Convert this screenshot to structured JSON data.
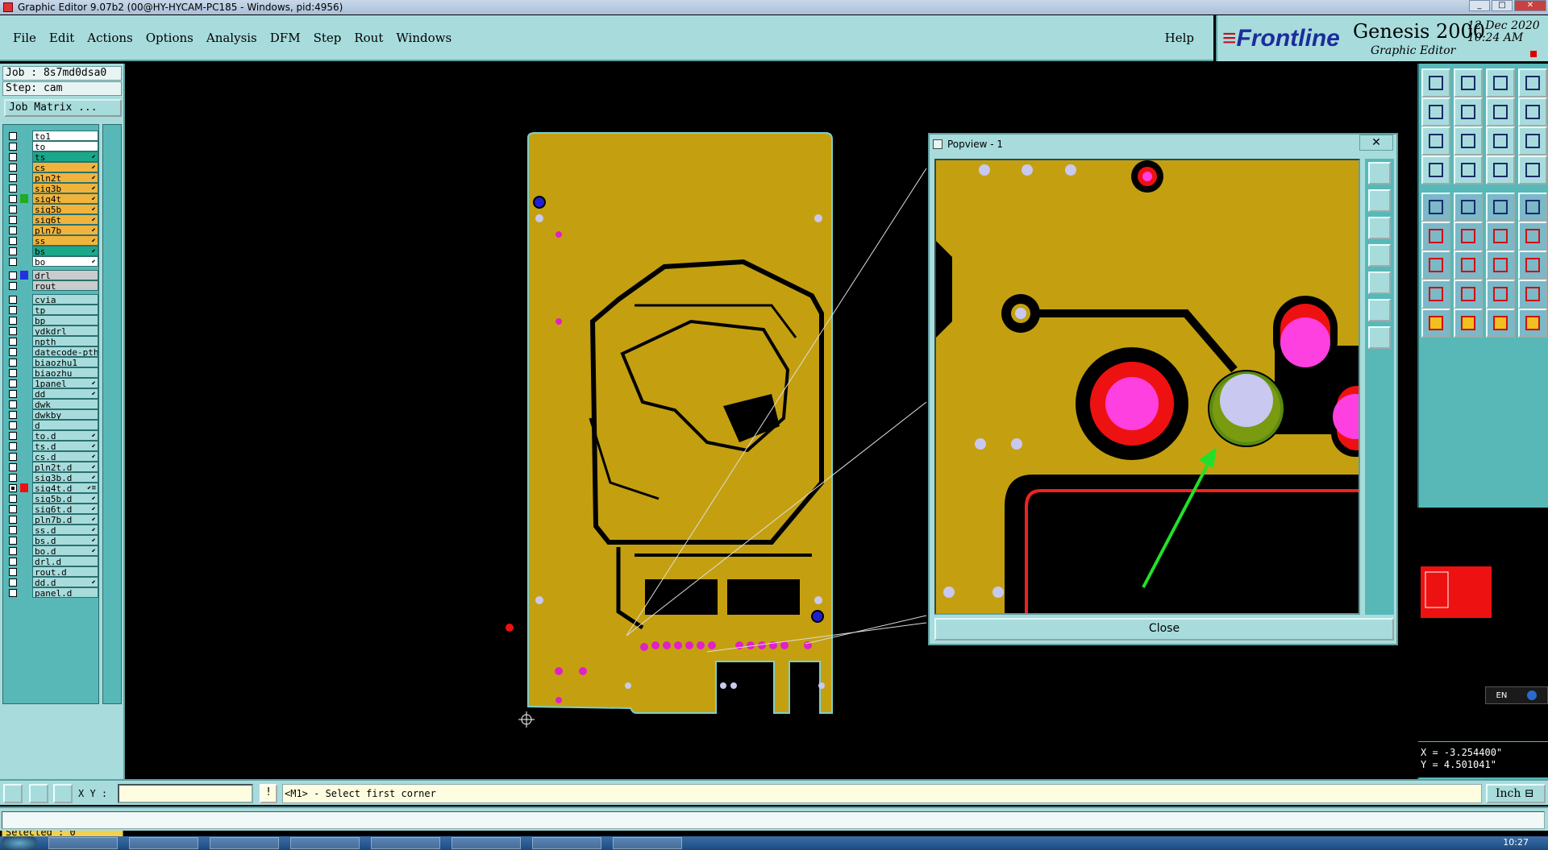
{
  "window": {
    "title": "Graphic Editor 9.07b2 (00@HY-HYCAM-PC185 - Windows, pid:4956)"
  },
  "menu": {
    "items": [
      "File",
      "Edit",
      "Actions",
      "Options",
      "Analysis",
      "DFM",
      "Step",
      "Rout",
      "Windows"
    ],
    "help": "Help"
  },
  "brand": {
    "logo": "Frontline",
    "product": "Genesis 2000",
    "subtitle": "Graphic Editor",
    "date": "12 Dec 2020",
    "time": "10:24 AM"
  },
  "job": {
    "job_label": "Job : 8s7md0dsa0",
    "step_label": "Step: cam",
    "matrix_button": "Job Matrix ..."
  },
  "layers": [
    {
      "name": "to1",
      "color": "#ffffff",
      "check": false,
      "swatch": "",
      "mark": ""
    },
    {
      "name": "to",
      "color": "#ffffff",
      "check": false,
      "swatch": "",
      "mark": ""
    },
    {
      "name": "ts",
      "color": "#1aa88a",
      "check": false,
      "swatch": "",
      "mark": "⬋"
    },
    {
      "name": "cs",
      "color": "#f0b43c",
      "check": false,
      "swatch": "",
      "mark": "⬋"
    },
    {
      "name": "pln2t",
      "color": "#f0b43c",
      "check": false,
      "swatch": "",
      "mark": "⬋"
    },
    {
      "name": "sig3b",
      "color": "#f0b43c",
      "check": false,
      "swatch": "",
      "mark": "⬋"
    },
    {
      "name": "sig4t",
      "color": "#f0b43c",
      "check": false,
      "swatch": "#22aa22",
      "mark": "⬋"
    },
    {
      "name": "sig5b",
      "color": "#f0b43c",
      "check": false,
      "swatch": "",
      "mark": "⬋"
    },
    {
      "name": "sig6t",
      "color": "#f0b43c",
      "check": false,
      "swatch": "",
      "mark": "⬋"
    },
    {
      "name": "pln7b",
      "color": "#f0b43c",
      "check": false,
      "swatch": "",
      "mark": "⬋"
    },
    {
      "name": "ss",
      "color": "#f0b43c",
      "check": false,
      "swatch": "",
      "mark": "⬋"
    },
    {
      "name": "bs",
      "color": "#1aa88a",
      "check": false,
      "swatch": "",
      "mark": "⬋"
    },
    {
      "name": "bo",
      "color": "#ffffff",
      "check": false,
      "swatch": "",
      "mark": "⬋"
    },
    {
      "name": "drl",
      "color": "#c8cccc",
      "check": false,
      "swatch": "#2233dd",
      "mark": ""
    },
    {
      "name": "rout",
      "color": "#c8cccc",
      "check": false,
      "swatch": "",
      "mark": ""
    },
    {
      "name": "cvia",
      "color": "#a8dcdc",
      "check": false,
      "swatch": "",
      "mark": ""
    },
    {
      "name": "tp",
      "color": "#a8dcdc",
      "check": false,
      "swatch": "",
      "mark": ""
    },
    {
      "name": "bp",
      "color": "#a8dcdc",
      "check": false,
      "swatch": "",
      "mark": ""
    },
    {
      "name": "ydkdrl",
      "color": "#a8dcdc",
      "check": false,
      "swatch": "",
      "mark": ""
    },
    {
      "name": "npth",
      "color": "#a8dcdc",
      "check": false,
      "swatch": "",
      "mark": ""
    },
    {
      "name": "datecode-pth",
      "color": "#a8dcdc",
      "check": false,
      "swatch": "",
      "mark": ""
    },
    {
      "name": "biaozhu1",
      "color": "#a8dcdc",
      "check": false,
      "swatch": "",
      "mark": ""
    },
    {
      "name": "biaozhu",
      "color": "#a8dcdc",
      "check": false,
      "swatch": "",
      "mark": ""
    },
    {
      "name": "1panel",
      "color": "#a8dcdc",
      "check": false,
      "swatch": "",
      "mark": "⬋"
    },
    {
      "name": "dd",
      "color": "#a8dcdc",
      "check": false,
      "swatch": "",
      "mark": "⬋"
    },
    {
      "name": "dwk",
      "color": "#a8dcdc",
      "check": false,
      "swatch": "",
      "mark": ""
    },
    {
      "name": "dwkby",
      "color": "#a8dcdc",
      "check": false,
      "swatch": "",
      "mark": ""
    },
    {
      "name": "d",
      "color": "#a8dcdc",
      "check": false,
      "swatch": "",
      "mark": ""
    },
    {
      "name": "to.d",
      "color": "#a8dcdc",
      "check": false,
      "swatch": "",
      "mark": "⬋"
    },
    {
      "name": "ts.d",
      "color": "#a8dcdc",
      "check": false,
      "swatch": "",
      "mark": "⬋"
    },
    {
      "name": "cs.d",
      "color": "#a8dcdc",
      "check": false,
      "swatch": "",
      "mark": "⬋"
    },
    {
      "name": "pln2t.d",
      "color": "#a8dcdc",
      "check": false,
      "swatch": "",
      "mark": "⬋"
    },
    {
      "name": "sig3b.d",
      "color": "#a8dcdc",
      "check": false,
      "swatch": "",
      "mark": "⬋"
    },
    {
      "name": "sig4t.d",
      "color": "#a8dcdc",
      "check": true,
      "swatch": "#ee1111",
      "mark": "⬋≡"
    },
    {
      "name": "sig5b.d",
      "color": "#a8dcdc",
      "check": false,
      "swatch": "",
      "mark": "⬋"
    },
    {
      "name": "sig6t.d",
      "color": "#a8dcdc",
      "check": false,
      "swatch": "",
      "mark": "⬋"
    },
    {
      "name": "pln7b.d",
      "color": "#a8dcdc",
      "check": false,
      "swatch": "",
      "mark": "⬋"
    },
    {
      "name": "ss.d",
      "color": "#a8dcdc",
      "check": false,
      "swatch": "",
      "mark": "⬋"
    },
    {
      "name": "bs.d",
      "color": "#a8dcdc",
      "check": false,
      "swatch": "",
      "mark": "⬋"
    },
    {
      "name": "bo.d",
      "color": "#a8dcdc",
      "check": false,
      "swatch": "",
      "mark": "⬋"
    },
    {
      "name": "drl.d",
      "color": "#a8dcdc",
      "check": false,
      "swatch": "",
      "mark": ""
    },
    {
      "name": "rout.d",
      "color": "#a8dcdc",
      "check": false,
      "swatch": "",
      "mark": ""
    },
    {
      "name": "dd.d",
      "color": "#a8dcdc",
      "check": false,
      "swatch": "",
      "mark": "⬋"
    },
    {
      "name": "panel.d",
      "color": "#a8dcdc",
      "check": false,
      "swatch": "",
      "mark": ""
    }
  ],
  "status": {
    "selected": "Selected : 0"
  },
  "popview": {
    "title": "Popview - 1",
    "close_x": "✕",
    "close_button": "Close"
  },
  "coords": {
    "x": "X = -3.254400\"",
    "y": "Y = 4.501041\""
  },
  "cmd": {
    "xy_label": "X Y :",
    "xy_value": "",
    "excl": "!",
    "prompt": "<M1> - Select first corner",
    "unit": "Inch ⊟"
  },
  "lang": {
    "code": "EN"
  },
  "taskbar": {
    "clock": "10:27"
  },
  "colors": {
    "panel": "#a8dcdc",
    "board": "#c8a000",
    "accent": "#1c2c9c"
  }
}
